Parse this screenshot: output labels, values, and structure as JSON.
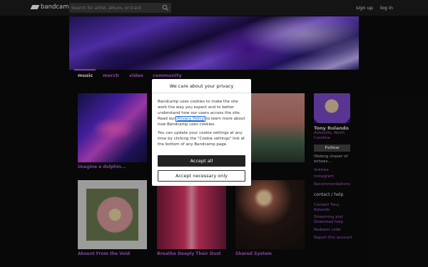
{
  "header": {
    "logo_text": "bandcamp",
    "search_placeholder": "Search for artist, album, or track",
    "signup_label": "sign up",
    "login_label": "log in"
  },
  "tabs": [
    {
      "label": "music",
      "active": true
    },
    {
      "label": "merch",
      "active": false
    },
    {
      "label": "video",
      "active": false
    },
    {
      "label": "community",
      "active": false
    }
  ],
  "albums": [
    {
      "title": "imagine a dolphin..."
    },
    {
      "title": ""
    },
    {
      "title": ""
    },
    {
      "title": "Absent From the Void"
    },
    {
      "title": "Breathe Deeply Their Dust"
    },
    {
      "title": "Shared System"
    }
  ],
  "sidebar": {
    "artist_name": "Tony Rolando",
    "location": "Asheville, North Carolina",
    "follow_label": "Follow",
    "bio": "lifelong chaser of echoes...",
    "links": [
      "linktree",
      "Instagram"
    ],
    "recommendations": "Recommendations",
    "contact_heading": "contact / help",
    "contact_links": [
      "Contact Tony Rolando",
      "Streaming and Download help",
      "Redeem code",
      "Report this account"
    ]
  },
  "cookie_dialog": {
    "title": "We care about your privacy",
    "text_before_link": "Bandcamp uses cookies to make the site work the way you expect and to better understand how our users access the site. Read our ",
    "privacy_link": "Privacy Policy",
    "text_after_link": " to learn more about how Bandcamp uses cookies.",
    "paragraph2": "You can update your cookie settings at any time by clicking the \"Cookie settings\" link at the bottom of any Bandcamp page.",
    "accept_all_label": "Accept all",
    "accept_necessary_label": "Accept necessary only"
  }
}
